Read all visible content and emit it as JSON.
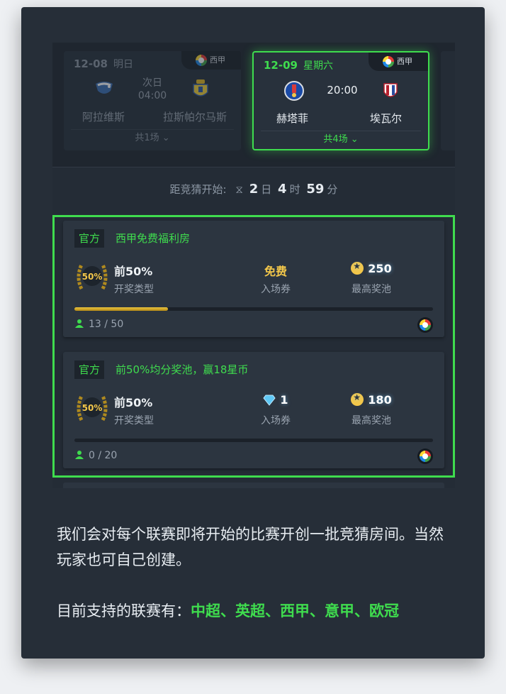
{
  "matches": [
    {
      "date": "12-08",
      "day": "明日",
      "league": "西甲",
      "home": "阿拉维斯",
      "away": "拉斯帕尔马斯",
      "time_line1": "次日",
      "time_line2": "04:00",
      "count": "共1场 ⌄"
    },
    {
      "date": "12-09",
      "day": "星期六",
      "league": "西甲",
      "home": "赫塔菲",
      "away": "埃瓦尔",
      "time": "20:00",
      "count": "共4场 ⌄"
    }
  ],
  "countdown": {
    "prefix": "距竞猜开始:",
    "days": "2",
    "days_unit": "日",
    "hours": "4",
    "hours_unit": "时",
    "minutes": "59",
    "minutes_unit": "分"
  },
  "rooms": [
    {
      "tag": "官方",
      "title": "西甲免费福利房",
      "type_value": "前50%",
      "type_label": "开奖类型",
      "entry_value": "免费",
      "entry_label": "入场券",
      "pool_value": "250",
      "pool_label": "最高奖池",
      "players": "13 / 50",
      "progress": 0.26
    },
    {
      "tag": "官方",
      "title": "前50%均分奖池，赢18星币",
      "type_value": "前50%",
      "type_label": "开奖类型",
      "entry_value": "1",
      "entry_label": "入场券",
      "pool_value": "180",
      "pool_label": "最高奖池",
      "players": "0 / 20",
      "progress": 0.0
    }
  ],
  "badge_text": "50%",
  "description": "我们会对每个联赛即将开始的比赛开创一批竞猜房间。当然玩家也可自己创建。",
  "supported": {
    "prefix": "目前支持的联赛有：",
    "list": "中超、英超、西甲、意甲、欧冠"
  },
  "colors": {
    "accent": "#3fdc4e",
    "gold": "#f3c74a",
    "background": "#262e38"
  }
}
